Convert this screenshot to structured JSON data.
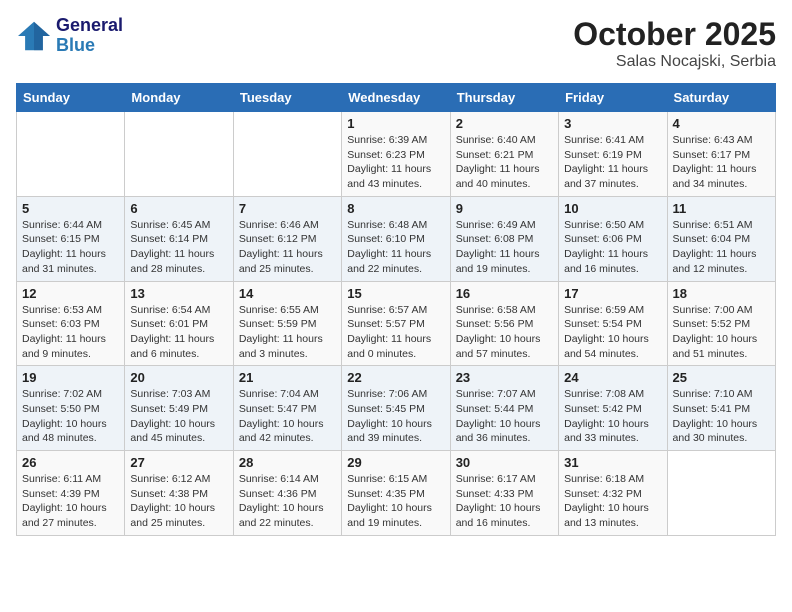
{
  "header": {
    "logo_line1": "General",
    "logo_line2": "Blue",
    "title": "October 2025",
    "subtitle": "Salas Nocajski, Serbia"
  },
  "calendar": {
    "weekdays": [
      "Sunday",
      "Monday",
      "Tuesday",
      "Wednesday",
      "Thursday",
      "Friday",
      "Saturday"
    ],
    "weeks": [
      [
        {
          "day": "",
          "info": ""
        },
        {
          "day": "",
          "info": ""
        },
        {
          "day": "",
          "info": ""
        },
        {
          "day": "1",
          "info": "Sunrise: 6:39 AM\nSunset: 6:23 PM\nDaylight: 11 hours\nand 43 minutes."
        },
        {
          "day": "2",
          "info": "Sunrise: 6:40 AM\nSunset: 6:21 PM\nDaylight: 11 hours\nand 40 minutes."
        },
        {
          "day": "3",
          "info": "Sunrise: 6:41 AM\nSunset: 6:19 PM\nDaylight: 11 hours\nand 37 minutes."
        },
        {
          "day": "4",
          "info": "Sunrise: 6:43 AM\nSunset: 6:17 PM\nDaylight: 11 hours\nand 34 minutes."
        }
      ],
      [
        {
          "day": "5",
          "info": "Sunrise: 6:44 AM\nSunset: 6:15 PM\nDaylight: 11 hours\nand 31 minutes."
        },
        {
          "day": "6",
          "info": "Sunrise: 6:45 AM\nSunset: 6:14 PM\nDaylight: 11 hours\nand 28 minutes."
        },
        {
          "day": "7",
          "info": "Sunrise: 6:46 AM\nSunset: 6:12 PM\nDaylight: 11 hours\nand 25 minutes."
        },
        {
          "day": "8",
          "info": "Sunrise: 6:48 AM\nSunset: 6:10 PM\nDaylight: 11 hours\nand 22 minutes."
        },
        {
          "day": "9",
          "info": "Sunrise: 6:49 AM\nSunset: 6:08 PM\nDaylight: 11 hours\nand 19 minutes."
        },
        {
          "day": "10",
          "info": "Sunrise: 6:50 AM\nSunset: 6:06 PM\nDaylight: 11 hours\nand 16 minutes."
        },
        {
          "day": "11",
          "info": "Sunrise: 6:51 AM\nSunset: 6:04 PM\nDaylight: 11 hours\nand 12 minutes."
        }
      ],
      [
        {
          "day": "12",
          "info": "Sunrise: 6:53 AM\nSunset: 6:03 PM\nDaylight: 11 hours\nand 9 minutes."
        },
        {
          "day": "13",
          "info": "Sunrise: 6:54 AM\nSunset: 6:01 PM\nDaylight: 11 hours\nand 6 minutes."
        },
        {
          "day": "14",
          "info": "Sunrise: 6:55 AM\nSunset: 5:59 PM\nDaylight: 11 hours\nand 3 minutes."
        },
        {
          "day": "15",
          "info": "Sunrise: 6:57 AM\nSunset: 5:57 PM\nDaylight: 11 hours\nand 0 minutes."
        },
        {
          "day": "16",
          "info": "Sunrise: 6:58 AM\nSunset: 5:56 PM\nDaylight: 10 hours\nand 57 minutes."
        },
        {
          "day": "17",
          "info": "Sunrise: 6:59 AM\nSunset: 5:54 PM\nDaylight: 10 hours\nand 54 minutes."
        },
        {
          "day": "18",
          "info": "Sunrise: 7:00 AM\nSunset: 5:52 PM\nDaylight: 10 hours\nand 51 minutes."
        }
      ],
      [
        {
          "day": "19",
          "info": "Sunrise: 7:02 AM\nSunset: 5:50 PM\nDaylight: 10 hours\nand 48 minutes."
        },
        {
          "day": "20",
          "info": "Sunrise: 7:03 AM\nSunset: 5:49 PM\nDaylight: 10 hours\nand 45 minutes."
        },
        {
          "day": "21",
          "info": "Sunrise: 7:04 AM\nSunset: 5:47 PM\nDaylight: 10 hours\nand 42 minutes."
        },
        {
          "day": "22",
          "info": "Sunrise: 7:06 AM\nSunset: 5:45 PM\nDaylight: 10 hours\nand 39 minutes."
        },
        {
          "day": "23",
          "info": "Sunrise: 7:07 AM\nSunset: 5:44 PM\nDaylight: 10 hours\nand 36 minutes."
        },
        {
          "day": "24",
          "info": "Sunrise: 7:08 AM\nSunset: 5:42 PM\nDaylight: 10 hours\nand 33 minutes."
        },
        {
          "day": "25",
          "info": "Sunrise: 7:10 AM\nSunset: 5:41 PM\nDaylight: 10 hours\nand 30 minutes."
        }
      ],
      [
        {
          "day": "26",
          "info": "Sunrise: 6:11 AM\nSunset: 4:39 PM\nDaylight: 10 hours\nand 27 minutes."
        },
        {
          "day": "27",
          "info": "Sunrise: 6:12 AM\nSunset: 4:38 PM\nDaylight: 10 hours\nand 25 minutes."
        },
        {
          "day": "28",
          "info": "Sunrise: 6:14 AM\nSunset: 4:36 PM\nDaylight: 10 hours\nand 22 minutes."
        },
        {
          "day": "29",
          "info": "Sunrise: 6:15 AM\nSunset: 4:35 PM\nDaylight: 10 hours\nand 19 minutes."
        },
        {
          "day": "30",
          "info": "Sunrise: 6:17 AM\nSunset: 4:33 PM\nDaylight: 10 hours\nand 16 minutes."
        },
        {
          "day": "31",
          "info": "Sunrise: 6:18 AM\nSunset: 4:32 PM\nDaylight: 10 hours\nand 13 minutes."
        },
        {
          "day": "",
          "info": ""
        }
      ]
    ]
  }
}
